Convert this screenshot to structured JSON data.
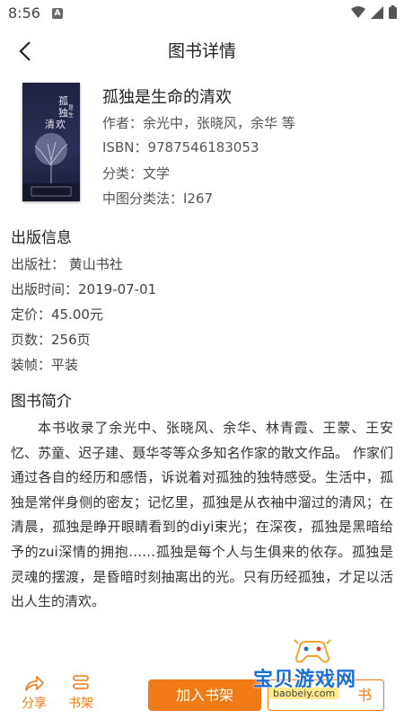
{
  "status_bar": {
    "time": "8:56",
    "app_indicator": "A"
  },
  "header": {
    "title": "图书详情"
  },
  "book": {
    "title": "孤独是生命的清欢",
    "author": "作者：余光中，张晓风，余华 等",
    "isbn": "ISBN：9787546183053",
    "category": "分类：文学",
    "clc": "中图分类法：I267",
    "cover_title": "孤独是生命的清欢",
    "cover_icon": "book-cover-tree"
  },
  "publish": {
    "heading": "出版信息",
    "publisher": "出版社：  黄山书社",
    "date": "出版时间：2019-07-01",
    "price": "定价：45.00元",
    "pages": "页数：256页",
    "binding": "装帧：平装"
  },
  "intro": {
    "heading": "图书简介",
    "text": "本书收录了余光中、张晓风、余华、林青霞、王蒙、王安忆、苏童、迟子建、聂华苓等众多知名作家的散文作品。 作家们通过各自的经历和感悟，诉说着对孤独的独特感受。生活中，孤独是常伴身侧的密友；记忆里，孤独是从衣袖中溜过的清风；在清晨，孤独是睁开眼睛看到的diyi束光；在深夜，孤独是黑暗给予的zui深情的拥抱……孤独是每个人与生俱来的依存。孤独是灵魂的摆渡，是昏暗时刻抽离出的光。只有历经孤独，才足以活出人生的清欢。"
  },
  "bottom_bar": {
    "share_label": "分享",
    "shelf_label": "书架",
    "add_shelf_label": "加入书架",
    "read_label": "书"
  },
  "watermark": {
    "text": "宝贝游戏网",
    "url": "baobeiy.com"
  },
  "colors": {
    "accent": "#f07a16",
    "watermark_blue": "#1b6fd6"
  }
}
